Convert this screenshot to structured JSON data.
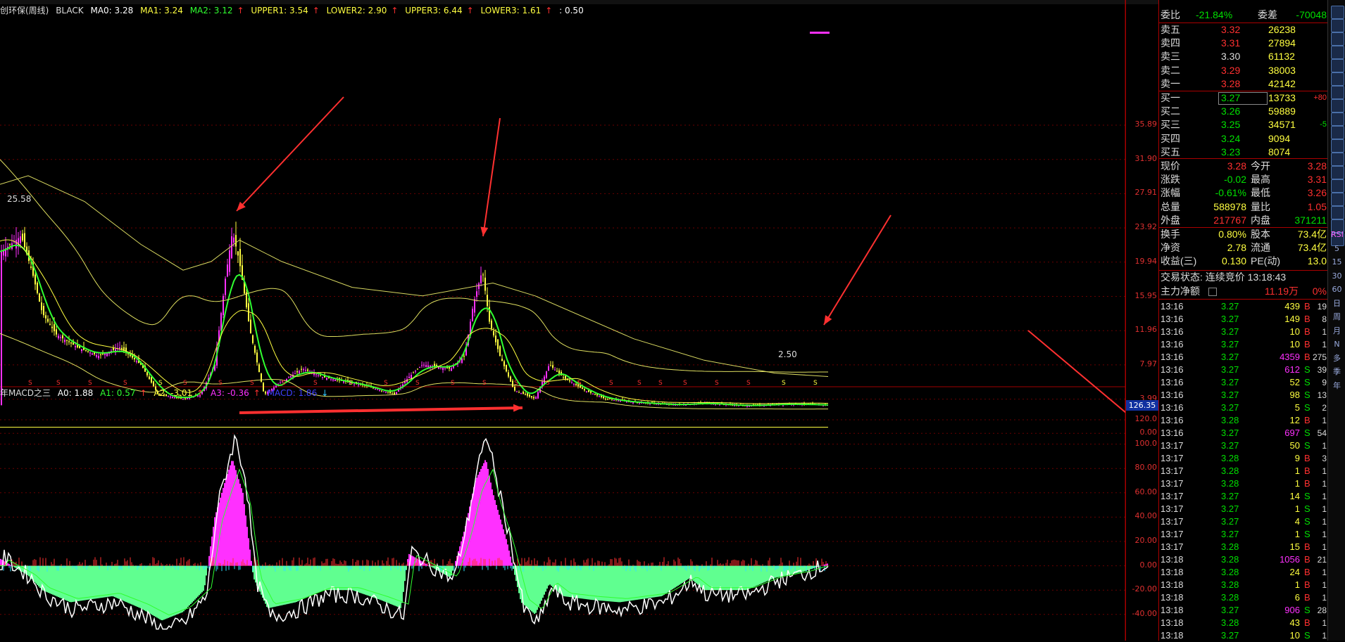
{
  "colors": {
    "up": "#ff3030",
    "down": "#00d000",
    "white": "#ffffff",
    "yellow": "#ffff40",
    "magenta": "#ff30ff",
    "green": "#30ff30",
    "cyan": "#30e0ff",
    "grid": "#800000",
    "mint": "#60ff90",
    "blue": "#4040ff"
  },
  "main_legend": {
    "title": "创环保(周线)",
    "black": "BLACK",
    "ma0": "MA0: 3.28",
    "ma1": "MA1: 3.24",
    "ma2": "MA2: 3.12",
    "upper1": "UPPER1: 3.54",
    "lower2": "LOWER2: 2.90",
    "upper3": "UPPER3: 6.44",
    "lower3": "LOWER3: 1.61",
    "extra": ": 0.50",
    "arrow": "↑"
  },
  "macd_legend": {
    "title": "年MACD之三",
    "a0": "A0: 1.88",
    "a1": "A1: 0.57",
    "a2": "A2: -3.01",
    "a3": "A3: -0.36",
    "macd": "MACD: 1.86",
    "up_arrow": "↑",
    "down_arrow": "↓"
  },
  "annotations": {
    "high": "25.58",
    "low": "2.50",
    "s_mark": "S"
  },
  "price_axis": [
    "35.89",
    "31.90",
    "27.91",
    "23.92",
    "19.94",
    "15.95",
    "11.96",
    "7.97",
    "3.99",
    "0.00"
  ],
  "macd_axis": [
    "120.0",
    "100.0",
    "80.00",
    "60.00",
    "40.00",
    "20.00",
    "0.00",
    "-20.00",
    "-40.00"
  ],
  "macd_top_label": "126.35",
  "quote": {
    "weibi_label": "委比",
    "weibi_val": "-21.84%",
    "weicha_label": "委差",
    "weicha_val": "-70048",
    "asks": [
      {
        "label": "卖五",
        "price": "3.32",
        "vol": "26238"
      },
      {
        "label": "卖四",
        "price": "3.31",
        "vol": "27894"
      },
      {
        "label": "卖三",
        "price": "3.30",
        "vol": "61132"
      },
      {
        "label": "卖二",
        "price": "3.29",
        "vol": "38003"
      },
      {
        "label": "卖一",
        "price": "3.28",
        "vol": "42142"
      }
    ],
    "bids": [
      {
        "label": "买一",
        "price": "3.27",
        "vol": "13733",
        "chg": "+80"
      },
      {
        "label": "买二",
        "price": "3.26",
        "vol": "59889",
        "chg": ""
      },
      {
        "label": "买三",
        "price": "3.25",
        "vol": "34571",
        "chg": "-5"
      },
      {
        "label": "买四",
        "price": "3.24",
        "vol": "9094",
        "chg": ""
      },
      {
        "label": "买五",
        "price": "3.23",
        "vol": "8074",
        "chg": ""
      }
    ],
    "stats": [
      {
        "l1": "现价",
        "v1": "3.28",
        "l2": "今开",
        "v2": "3.28"
      },
      {
        "l1": "涨跌",
        "v1": "-0.02",
        "l2": "最高",
        "v2": "3.31"
      },
      {
        "l1": "涨幅",
        "v1": "-0.61%",
        "l2": "最低",
        "v2": "3.26"
      },
      {
        "l1": "总量",
        "v1": "588978",
        "l2": "量比",
        "v2": "1.05"
      },
      {
        "l1": "外盘",
        "v1": "217767",
        "l2": "内盘",
        "v2": "371211"
      }
    ],
    "stats2": [
      {
        "l1": "换手",
        "v1": "0.80%",
        "l2": "股本",
        "v2": "73.4亿"
      },
      {
        "l1": "净资",
        "v1": "2.78",
        "l2": "流通",
        "v2": "73.4亿"
      },
      {
        "l1": "收益(三)",
        "v1": "0.130",
        "l2": "PE(动)",
        "v2": "13.0"
      }
    ],
    "trade_status": "交易状态: 连续竞价 13:18:43",
    "main_net_label": "主力净额",
    "main_net_val": "11.19万",
    "main_net_pct": "0%"
  },
  "ticks": [
    {
      "t": "13:16",
      "p": "3.27",
      "v": "439",
      "s": "B",
      "n": "19"
    },
    {
      "t": "13:16",
      "p": "3.27",
      "v": "149",
      "s": "B",
      "n": "8"
    },
    {
      "t": "13:16",
      "p": "3.27",
      "v": "10",
      "s": "B",
      "n": "1"
    },
    {
      "t": "13:16",
      "p": "3.27",
      "v": "10",
      "s": "B",
      "n": "1"
    },
    {
      "t": "13:16",
      "p": "3.27",
      "v": "4359",
      "s": "B",
      "n": "275"
    },
    {
      "t": "13:16",
      "p": "3.27",
      "v": "612",
      "s": "S",
      "n": "39"
    },
    {
      "t": "13:16",
      "p": "3.27",
      "v": "52",
      "s": "S",
      "n": "9"
    },
    {
      "t": "13:16",
      "p": "3.27",
      "v": "98",
      "s": "S",
      "n": "13"
    },
    {
      "t": "13:16",
      "p": "3.27",
      "v": "5",
      "s": "S",
      "n": "2"
    },
    {
      "t": "13:16",
      "p": "3.28",
      "v": "12",
      "s": "B",
      "n": "1"
    },
    {
      "t": "13:16",
      "p": "3.27",
      "v": "697",
      "s": "S",
      "n": "54"
    },
    {
      "t": "13:17",
      "p": "3.27",
      "v": "50",
      "s": "S",
      "n": "1"
    },
    {
      "t": "13:17",
      "p": "3.28",
      "v": "9",
      "s": "B",
      "n": "3"
    },
    {
      "t": "13:17",
      "p": "3.28",
      "v": "1",
      "s": "B",
      "n": "1"
    },
    {
      "t": "13:17",
      "p": "3.28",
      "v": "1",
      "s": "B",
      "n": "1"
    },
    {
      "t": "13:17",
      "p": "3.27",
      "v": "14",
      "s": "S",
      "n": "1"
    },
    {
      "t": "13:17",
      "p": "3.27",
      "v": "1",
      "s": "S",
      "n": "1"
    },
    {
      "t": "13:17",
      "p": "3.27",
      "v": "4",
      "s": "S",
      "n": "1"
    },
    {
      "t": "13:17",
      "p": "3.27",
      "v": "1",
      "s": "S",
      "n": "1"
    },
    {
      "t": "13:17",
      "p": "3.28",
      "v": "15",
      "s": "B",
      "n": "1"
    },
    {
      "t": "13:18",
      "p": "3.28",
      "v": "1056",
      "s": "B",
      "n": "21"
    },
    {
      "t": "13:18",
      "p": "3.28",
      "v": "24",
      "s": "B",
      "n": "1"
    },
    {
      "t": "13:18",
      "p": "3.28",
      "v": "1",
      "s": "B",
      "n": "1"
    },
    {
      "t": "13:18",
      "p": "3.28",
      "v": "6",
      "s": "B",
      "n": "1"
    },
    {
      "t": "13:18",
      "p": "3.27",
      "v": "906",
      "s": "S",
      "n": "28"
    },
    {
      "t": "13:18",
      "p": "3.28",
      "v": "43",
      "s": "B",
      "n": "1"
    },
    {
      "t": "13:18",
      "p": "3.27",
      "v": "10",
      "s": "S",
      "n": "1"
    }
  ],
  "toolbar": [
    "RSI",
    "5",
    "15",
    "30",
    "60",
    "日",
    "周",
    "月",
    "N",
    "多",
    "季",
    "年"
  ]
}
